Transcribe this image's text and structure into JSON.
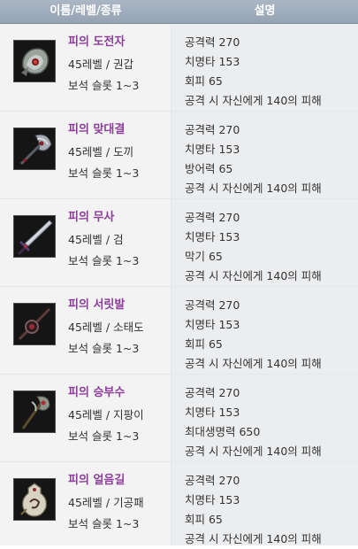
{
  "header": {
    "name_col": "이름/레벨/종류",
    "desc_col": "설명"
  },
  "items": [
    {
      "name": "피의 도전자",
      "meta": "45레벨 / 권갑",
      "slots": "보석 슬롯 1~3",
      "icon": "gauntlet-icon",
      "desc": [
        "공격력 270",
        "치명타 153",
        "회피 65",
        "공격 시 자신에게 140의 피해"
      ]
    },
    {
      "name": "피의 맞대결",
      "meta": "45레벨 / 도끼",
      "slots": "보석 슬롯 1~3",
      "icon": "axe-icon",
      "desc": [
        "공격력 270",
        "치명타 153",
        "방어력 65",
        "공격 시 자신에게 140의 피해"
      ]
    },
    {
      "name": "피의 무사",
      "meta": "45레벨 / 검",
      "slots": "보석 슬롯 1~3",
      "icon": "sword-icon",
      "desc": [
        "공격력 270",
        "치명타 153",
        "막기 65",
        "공격 시 자신에게 140의 피해"
      ]
    },
    {
      "name": "피의 서릿발",
      "meta": "45레벨 / 소태도",
      "slots": "보석 슬롯 1~3",
      "icon": "short-sword-icon",
      "desc": [
        "공격력 270",
        "치명타 153",
        "회피 65",
        "공격 시 자신에게 140의 피해"
      ]
    },
    {
      "name": "피의 승부수",
      "meta": "45레벨 / 지팡이",
      "slots": "보석 슬롯 1~3",
      "icon": "staff-icon",
      "desc": [
        "공격력 270",
        "치명타 153",
        "최대생명력 650",
        "공격 시 자신에게 140의 피해"
      ]
    },
    {
      "name": "피의 얼음길",
      "meta": "45레벨 / 기공패",
      "slots": "보석 슬롯 1~3",
      "icon": "talisman-icon",
      "desc": [
        "공격력 270",
        "치명타 153",
        "회피 65",
        "공격 시 자신에게 140의 피해"
      ]
    }
  ]
}
